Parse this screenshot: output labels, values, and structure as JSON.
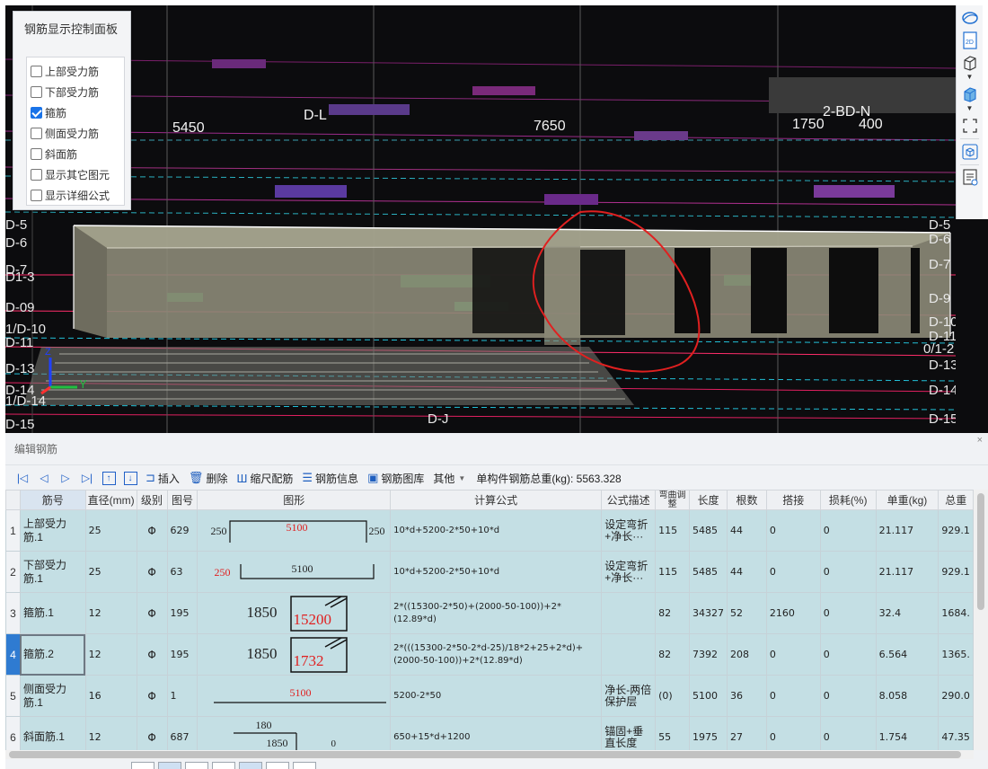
{
  "viewport": {
    "dimensions_top": [
      "5450",
      "D-L",
      "7650",
      "1750",
      "2-BD-N",
      "400"
    ],
    "left_axis_labels": [
      "D-5",
      "D-6",
      "D-7",
      "D1-3",
      "D-09",
      "1/D-10",
      "D-11",
      "D-13",
      "D-14",
      "1/D-14",
      "D-15"
    ],
    "right_axis_labels": [
      "D-5",
      "D-6",
      "D-7",
      "D-9",
      "D-10",
      "D-11",
      "0/1-2",
      "D-13",
      "D-14",
      "D-15"
    ],
    "bottom_label": "D-J",
    "axis_y_label": "Y",
    "axis_z_label": "Z"
  },
  "panel": {
    "title": "钢筋显示控制面板",
    "options": [
      {
        "label": "上部受力筋",
        "checked": false
      },
      {
        "label": "下部受力筋",
        "checked": false
      },
      {
        "label": "箍筋",
        "checked": true
      },
      {
        "label": "侧面受力筋",
        "checked": false
      },
      {
        "label": "斜面筋",
        "checked": false
      },
      {
        "label": "显示其它图元",
        "checked": false
      },
      {
        "label": "显示详细公式",
        "checked": false
      }
    ]
  },
  "right_tools": {
    "icons": [
      "orbit-icon",
      "2d-view-icon",
      "3d-box-icon",
      "3d-box-filled-icon",
      "fit-view-icon",
      "cube-view-icon",
      "report-icon"
    ],
    "label_2d": "2D"
  },
  "editor": {
    "title": "编辑钢筋",
    "close": "×",
    "toolbar": {
      "insert": "插入",
      "delete": "删除",
      "scale_rebar": "缩尺配筋",
      "rebar_info": "钢筋信息",
      "rebar_library": "钢筋图库",
      "other": "其他",
      "total_weight_label": "单构件钢筋总重(kg): 5563.328"
    },
    "columns": [
      "筋号",
      "直径(mm)",
      "级别",
      "图号",
      "图形",
      "计算公式",
      "公式描述",
      "弯曲调整",
      "长度",
      "根数",
      "搭接",
      "损耗(%)",
      "单重(kg)",
      "总重"
    ],
    "rows": [
      {
        "num": "1",
        "name": "上部受力筋.1",
        "diameter": "25",
        "grade": "Φ",
        "fig": "629",
        "shape": {
          "left": "250",
          "mid": "5100",
          "right": "250"
        },
        "formula": "10*d+5200-2*50+10*d",
        "desc": "设定弯折+净长···",
        "bend": "115",
        "length": "5485",
        "count": "44",
        "lap": "0",
        "loss": "0",
        "unit_wt": "21.117",
        "total_wt": "929.1"
      },
      {
        "num": "2",
        "name": "下部受力筋.1",
        "diameter": "25",
        "grade": "Φ",
        "fig": "63",
        "shape": {
          "left": "250",
          "mid": "5100"
        },
        "formula": "10*d+5200-2*50+10*d",
        "desc": "设定弯折+净长···",
        "bend": "115",
        "length": "5485",
        "count": "44",
        "lap": "0",
        "loss": "0",
        "unit_wt": "21.117",
        "total_wt": "929.1"
      },
      {
        "num": "3",
        "name": "箍筋.1",
        "diameter": "12",
        "grade": "Φ",
        "fig": "195",
        "shape": {
          "left": "1850",
          "mid": "15200"
        },
        "formula": "2*((15300-2*50)+(2000-50-100))+2*(12.89*d)",
        "desc": "",
        "bend": "82",
        "length": "34327",
        "count": "52",
        "lap": "2160",
        "loss": "0",
        "unit_wt": "32.4",
        "total_wt": "1684."
      },
      {
        "num": "4",
        "name": "箍筋.2",
        "diameter": "12",
        "grade": "Φ",
        "fig": "195",
        "shape": {
          "left": "1850",
          "mid": "1732"
        },
        "formula": "2*(((15300-2*50-2*d-25)/18*2+25+2*d)+(2000-50-100))+2*(12.89*d)",
        "desc": "",
        "bend": "82",
        "length": "7392",
        "count": "208",
        "lap": "0",
        "loss": "0",
        "unit_wt": "6.564",
        "total_wt": "1365."
      },
      {
        "num": "5",
        "name": "侧面受力筋.1",
        "diameter": "16",
        "grade": "Φ",
        "fig": "1",
        "shape": {
          "mid": "5100"
        },
        "formula": "5200-2*50",
        "desc": "净长-两倍保护层",
        "bend": "(0)",
        "length": "5100",
        "count": "36",
        "lap": "0",
        "loss": "0",
        "unit_wt": "8.058",
        "total_wt": "290.0"
      },
      {
        "num": "6",
        "name": "斜面筋.1",
        "diameter": "12",
        "grade": "Φ",
        "fig": "687",
        "shape": {
          "top": "180",
          "mid": "1850",
          "right": "0"
        },
        "formula": "650+15*d+1200",
        "desc": "锚固+垂直长度",
        "bend": "55",
        "length": "1975",
        "count": "27",
        "lap": "0",
        "loss": "0",
        "unit_wt": "1.754",
        "total_wt": "47.35"
      }
    ]
  }
}
